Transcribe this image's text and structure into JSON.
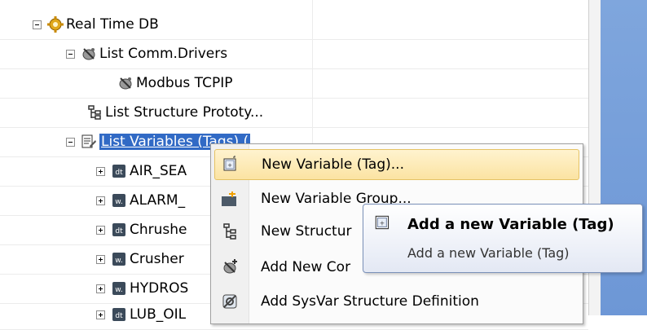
{
  "tree": {
    "root": {
      "label": "Real Time DB",
      "icon": "gear-icon"
    },
    "comm_drivers": {
      "label": "List Comm.Drivers",
      "icon": "satellite-icon"
    },
    "modbus": {
      "label": "Modbus TCPIP",
      "icon": "satellite-icon"
    },
    "structure_prototypes": {
      "label": "List Structure Prototy...",
      "icon": "structure-icon"
    },
    "variables": {
      "label": "List Variables (Tags) (",
      "icon": "variables-list-icon"
    },
    "tags": [
      {
        "label": "AIR_SEA",
        "icon": "data-tag-icon"
      },
      {
        "label": "ALARM_",
        "icon": "word-tag-icon"
      },
      {
        "label": "Chrushe",
        "icon": "data-tag-icon"
      },
      {
        "label": "Crusher",
        "icon": "word-tag-icon"
      },
      {
        "label": "HYDROS",
        "icon": "word-tag-icon"
      },
      {
        "label": "LUB_OIL",
        "icon": "data-tag-icon"
      }
    ]
  },
  "context_menu": {
    "items": [
      {
        "label": "New Variable (Tag)...",
        "icon": "new-tag-icon",
        "highlighted": true
      },
      {
        "label": "New Variable Group...",
        "icon": "new-group-icon"
      },
      {
        "label": "New Structur",
        "icon": "new-structure-icon"
      },
      {
        "label": "Add New Cor",
        "icon": "add-driver-icon"
      },
      {
        "label": "Add SysVar Structure Definition",
        "icon": "sysvar-icon"
      }
    ]
  },
  "tooltip": {
    "title": "Add a new Variable (Tag)",
    "body": "Add a new Variable (Tag)",
    "icon": "new-tag-icon"
  },
  "colors": {
    "selection": "#316ac5",
    "menu_highlight": "#fbe3a2",
    "side_panel": "#7fa6dd"
  }
}
